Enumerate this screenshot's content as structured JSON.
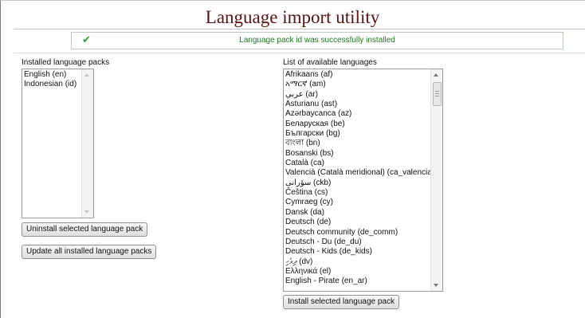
{
  "page": {
    "title": "Language import utility",
    "notice": {
      "message": "Language pack id was successfully installed",
      "icon": "check-icon"
    }
  },
  "installed": {
    "label": "Installed language packs",
    "items": [
      "English (en)",
      "Indonesian (id)"
    ],
    "uninstall_button": "Uninstall selected language pack",
    "update_button": "Update all installed language packs"
  },
  "available": {
    "label": "List of available languages",
    "items": [
      "Afrikaans (af)",
      "አማርኛ (am)",
      "عربي (ar)",
      "Asturianu (ast)",
      "Azərbaycanca (az)",
      "Беларуская (be)",
      "Български (bg)",
      "বাংলা (bn)",
      "Bosanski (bs)",
      "Català (ca)",
      "Valencià (Català meridional) (ca_valencia)",
      "سۆرانی (ckb)",
      "Čeština (cs)",
      "Cymraeg (cy)",
      "Dansk (da)",
      "Deutsch (de)",
      "Deutsch community (de_comm)",
      "Deutsch - Du (de_du)",
      "Deutsch - Kids (de_kids)",
      "ދިވެހި (dv)",
      "Ελληνικά (el)",
      "English - Pirate (en_ar)"
    ],
    "install_button": "Install selected language pack"
  },
  "colors": {
    "title": "#5a1313",
    "success": "#1e7a1e",
    "check": "#2e9b2e"
  }
}
